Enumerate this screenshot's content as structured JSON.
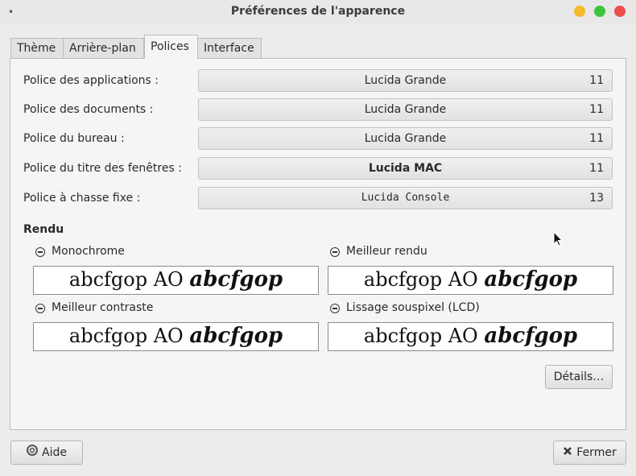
{
  "window": {
    "title": "Préférences de l'apparence",
    "menu_glyph": "•"
  },
  "tabs": [
    {
      "label": "Thème"
    },
    {
      "label": "Arrière-plan"
    },
    {
      "label": "Polices"
    },
    {
      "label": "Interface"
    }
  ],
  "active_tab": "Polices",
  "fonts": [
    {
      "label": "Police des applications :",
      "font": "Lucida Grande",
      "size": "11"
    },
    {
      "label": "Police des documents :",
      "font": "Lucida Grande",
      "size": "11"
    },
    {
      "label": "Police du bureau :",
      "font": "Lucida Grande",
      "size": "11"
    },
    {
      "label": "Police du titre des fenêtres :",
      "font": "Lucida MAC",
      "size": "11"
    },
    {
      "label": "Police à chasse fixe :",
      "font": "Lucida Console",
      "size": "13"
    }
  ],
  "rendering": {
    "title": "Rendu",
    "options": [
      {
        "label": "Monochrome",
        "sample_regular": "abcfgop AO ",
        "sample_italic": "abcfgop"
      },
      {
        "label": "Meilleur rendu",
        "sample_regular": "abcfgop AO ",
        "sample_italic": "abcfgop"
      },
      {
        "label": "Meilleur contraste",
        "sample_regular": "abcfgop AO ",
        "sample_italic": "abcfgop"
      },
      {
        "label": "Lissage souspixel (LCD)",
        "sample_regular": "abcfgop AO ",
        "sample_italic": "abcfgop"
      }
    ]
  },
  "buttons": {
    "details": "Détails…",
    "help": "Aide",
    "close": "Fermer"
  },
  "icons": {
    "help": "lifebuoy-icon",
    "close": "x-icon"
  }
}
